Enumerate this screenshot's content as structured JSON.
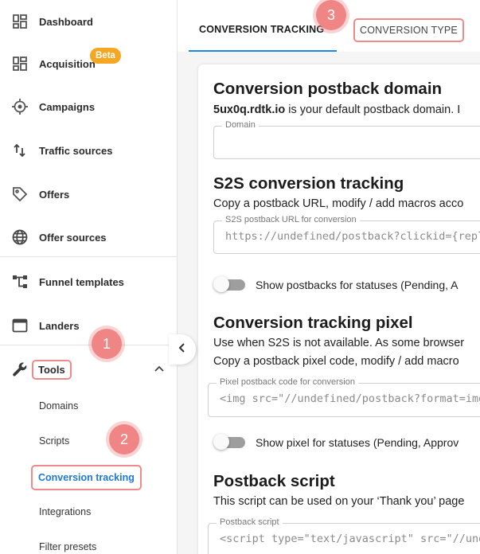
{
  "sidebar": {
    "items": [
      {
        "label": "Dashboard",
        "icon": "dashboard-icon"
      },
      {
        "label": "Acquisition",
        "icon": "dashboard-icon",
        "badge": "Beta"
      },
      {
        "label": "Campaigns",
        "icon": "target-icon"
      },
      {
        "label": "Traffic sources",
        "icon": "arrows-icon"
      },
      {
        "label": "Offers",
        "icon": "tag-icon"
      },
      {
        "label": "Offer sources",
        "icon": "globe-icon"
      },
      {
        "label": "Funnel templates",
        "icon": "funnel-icon"
      },
      {
        "label": "Landers",
        "icon": "window-icon"
      },
      {
        "label": "Tools",
        "icon": "wrench-icon"
      }
    ],
    "tools_submenu": [
      "Domains",
      "Scripts",
      "Conversion tracking",
      "Integrations",
      "Filter presets"
    ],
    "active_item": "Conversion tracking"
  },
  "steps": [
    "1",
    "2",
    "3"
  ],
  "tabs": [
    {
      "label": "CONVERSION TRACKING",
      "active": true
    },
    {
      "label": "CONVERSION TYPE",
      "active": false
    }
  ],
  "content": {
    "domain_section": {
      "title": "Conversion postback domain",
      "desc_bold": "5ux0q.rdtk.io",
      "desc_rest": " is your default postback domain. I",
      "field_label": "Domain",
      "field_value": ""
    },
    "s2s_section": {
      "title": "S2S conversion tracking",
      "desc": "Copy a postback URL, modify / add macros acco",
      "field_label": "S2S postback URL for conversion",
      "field_value": "https://undefined/postback?clickid={replace_m",
      "toggle_label": "Show postbacks for statuses (Pending, A"
    },
    "pixel_section": {
      "title": "Conversion tracking pixel",
      "desc1": "Use when S2S is not available. As some browser",
      "desc2": "Copy a postback pixel code, modify / add macro",
      "field_label": "Pixel postback code for conversion",
      "field_value": "<img src=\"//undefined/postback?format=img&",
      "toggle_label": "Show pixel for statuses (Pending, Approv"
    },
    "script_section": {
      "title": "Postback script",
      "desc": "This script can be used on your ‘Thank you’ page",
      "field_label": "Postback script",
      "field_value": "<script type=\"text/javascript\" src=\"//undefined/"
    }
  },
  "colors": {
    "accent": "#1e88e5",
    "badge": "#f5a623",
    "highlight": "#f08a8a"
  }
}
